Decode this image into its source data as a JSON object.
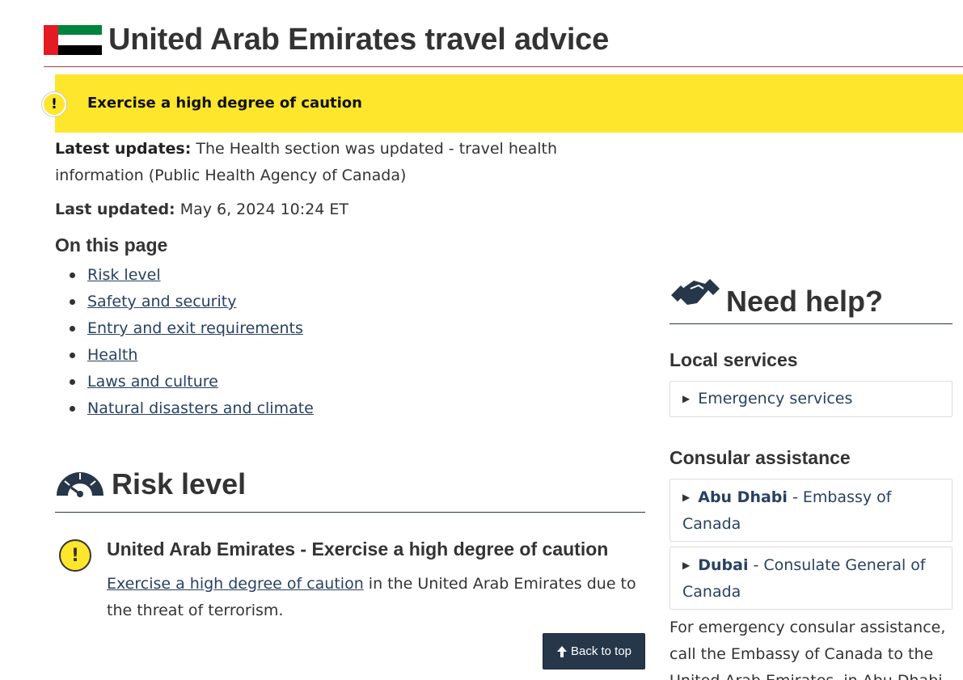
{
  "header": {
    "title": "United Arab Emirates travel advice",
    "flag_colors": {
      "red": "#e31b23",
      "green": "#00843d",
      "white": "#ffffff",
      "black": "#000000"
    }
  },
  "alert": {
    "icon": "exclamation-icon",
    "text": "Exercise a high degree of caution",
    "color": "#fee62c"
  },
  "updates": {
    "latest_label": "Latest updates:",
    "latest_text": " The Health section was updated - travel health information (Public Health Agency of Canada)",
    "last_label": "Last updated:",
    "last_text": " May 6, 2024 10:24 ET"
  },
  "on_this_page": {
    "heading": "On this page",
    "items": [
      {
        "label": "Risk level"
      },
      {
        "label": "Safety and security"
      },
      {
        "label": "Entry and exit requirements"
      },
      {
        "label": "Health"
      },
      {
        "label": "Laws and culture"
      },
      {
        "label": "Natural disasters and climate"
      }
    ]
  },
  "risk": {
    "heading": "Risk level",
    "icon": "gauge-icon",
    "subheading": "United Arab Emirates - Exercise a high degree of caution",
    "link_text": "Exercise a high degree of caution",
    "desc_text": " in the United Arab Emirates due to the threat of terrorism."
  },
  "back_to_top": {
    "label": "Back to top",
    "icon": "arrow-up-icon"
  },
  "help": {
    "heading": "Need help?",
    "icon": "handshake-icon",
    "local_heading": "Local services",
    "local_items": [
      {
        "label": "Emergency services"
      }
    ],
    "consular_heading": "Consular assistance",
    "consular_items": [
      {
        "name": "Abu Dhabi",
        "rest": " - Embassy of Canada"
      },
      {
        "name": "Dubai",
        "rest": " - Consulate General of Canada"
      }
    ],
    "footer_text": "For emergency consular assistance, call the Embassy of Canada to the United Arab Emirates, in Abu Dhabi"
  }
}
